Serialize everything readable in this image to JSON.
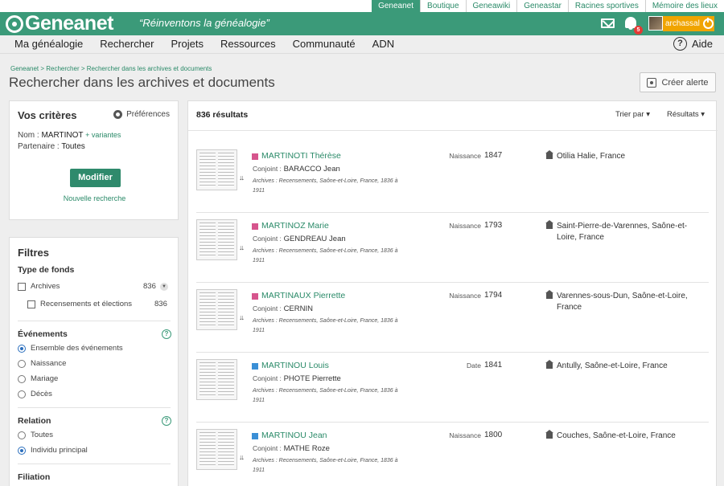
{
  "topbar": {
    "links": [
      {
        "label": "Geneanet",
        "active": true
      },
      {
        "label": "Boutique",
        "active": false
      },
      {
        "label": "Geneawiki",
        "active": false
      },
      {
        "label": "Geneastar",
        "active": false
      },
      {
        "label": "Racines sportives",
        "active": false
      },
      {
        "label": "Mémoire des lieux",
        "active": false
      }
    ]
  },
  "header": {
    "logo": "Geneanet",
    "tagline": "“Réinventons la généalogie”",
    "notification_count": "5",
    "username": "archassal"
  },
  "nav": {
    "items": [
      "Ma généalogie",
      "Rechercher",
      "Projets",
      "Ressources",
      "Communauté",
      "ADN"
    ],
    "help": "Aide"
  },
  "page": {
    "breadcrumb": "Geneanet > Rechercher > Rechercher dans les archives et documents",
    "title": "Rechercher dans les archives et documents",
    "alert_button": "Créer alerte"
  },
  "criteria": {
    "title": "Vos critères",
    "preferences": "Préférences",
    "nom_label": "Nom :",
    "nom_value": "MARTINOT",
    "variants": "+ variantes",
    "partner_label": "Partenaire :",
    "partner_value": "Toutes",
    "modify_button": "Modifier",
    "new_search": "Nouvelle recherche"
  },
  "filters": {
    "title": "Filtres",
    "fund_type": {
      "title": "Type de fonds",
      "items": [
        {
          "label": "Archives",
          "count": "836"
        },
        {
          "label": "Recensements et élections",
          "count": "836"
        }
      ]
    },
    "events": {
      "title": "Événements",
      "options": [
        "Ensemble des événements",
        "Naissance",
        "Mariage",
        "Décès"
      ],
      "selected": "Ensemble des événements"
    },
    "relation": {
      "title": "Relation",
      "options": [
        "Toutes",
        "Individu principal"
      ],
      "selected": "Individu principal"
    },
    "filiation": {
      "title": "Filiation"
    }
  },
  "results": {
    "count_label": "836 résultats",
    "sort_label": "Trier par",
    "results_menu": "Résultats",
    "spouse_label": "Conjoint :",
    "items": [
      {
        "name": "MARTINOTI Thérèse",
        "tag_color": "#d6558d",
        "spouse": "BARACCO Jean",
        "source": "Archives : Recensements, Saône-et-Loire, France, 1836 à 1911",
        "event_type": "Naissance",
        "year": "1847",
        "place": "Otilia Halie, France"
      },
      {
        "name": "MARTINOZ Marie",
        "tag_color": "#d6558d",
        "spouse": "GENDREAU Jean",
        "source": "Archives : Recensements, Saône-et-Loire, France, 1836 à 1911",
        "event_type": "Naissance",
        "year": "1793",
        "place": "Saint-Pierre-de-Varennes, Saône-et-Loire, France"
      },
      {
        "name": "MARTINAUX Pierrette",
        "tag_color": "#d6558d",
        "spouse": "CERNIN",
        "source": "Archives : Recensements, Saône-et-Loire, France, 1836 à 1911",
        "event_type": "Naissance",
        "year": "1794",
        "place": "Varennes-sous-Dun, Saône-et-Loire, France"
      },
      {
        "name": "MARTINOU Louis",
        "tag_color": "#3a8fd6",
        "spouse": "PHOTE Pierrette",
        "source": "Archives : Recensements, Saône-et-Loire, France, 1836 à 1911",
        "event_type": "Date",
        "year": "1841",
        "place": "Antully, Saône-et-Loire, France"
      },
      {
        "name": "MARTINOU Jean",
        "tag_color": "#3a8fd6",
        "spouse": "MATHE Roze",
        "source": "Archives : Recensements, Saône-et-Loire, France, 1836 à 1911",
        "event_type": "Naissance",
        "year": "1800",
        "place": "Couches, Saône-et-Loire, France"
      }
    ]
  }
}
